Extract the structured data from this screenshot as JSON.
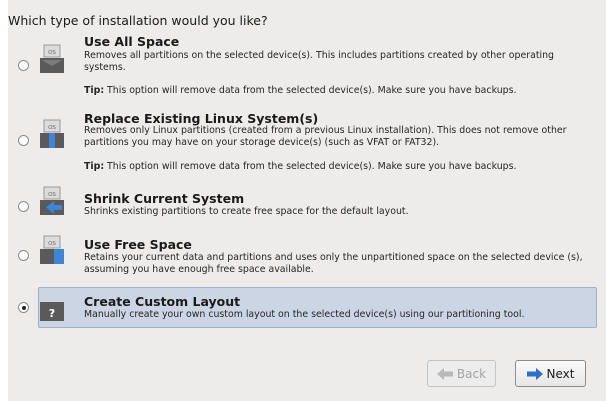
{
  "question": "Which type of installation would you like?",
  "options": [
    {
      "title": "Use All Space",
      "description": "Removes all partitions on the selected device(s).  This includes partitions created by other operating systems.",
      "tip_label": "Tip:",
      "tip_text": " This option will remove data from the selected device(s).  Make sure you have backups.",
      "icon": "disk-os-icon",
      "selected": false
    },
    {
      "title": "Replace Existing Linux System(s)",
      "description": "Removes only Linux partitions (created from a previous Linux installation).  This does not remove other partitions you may have on your storage device(s) (such as VFAT or FAT32).",
      "tip_label": "Tip:",
      "tip_text": " This option will remove data from the selected device(s).  Make sure you have backups.",
      "icon": "disk-os-linux-icon",
      "selected": false
    },
    {
      "title": "Shrink Current System",
      "description": "Shrinks existing partitions to create free space for the default layout.",
      "icon": "disk-shrink-icon",
      "selected": false
    },
    {
      "title": "Use Free Space",
      "description": "Retains your current data and partitions and uses only the unpartitioned space on the selected device (s), assuming you have enough free space available.",
      "icon": "disk-free-space-icon",
      "selected": false
    },
    {
      "title": "Create Custom Layout",
      "description": "Manually create your own custom layout on the selected device(s) using our partitioning tool.",
      "icon": "custom-layout-icon",
      "icon_glyph": "?",
      "selected": true
    }
  ],
  "icon_badge": "OS",
  "buttons": {
    "back": "Back",
    "next": "Next"
  },
  "colors": {
    "selected_row": "#cbd5e3",
    "accent_blue": "#2f6fc7"
  }
}
